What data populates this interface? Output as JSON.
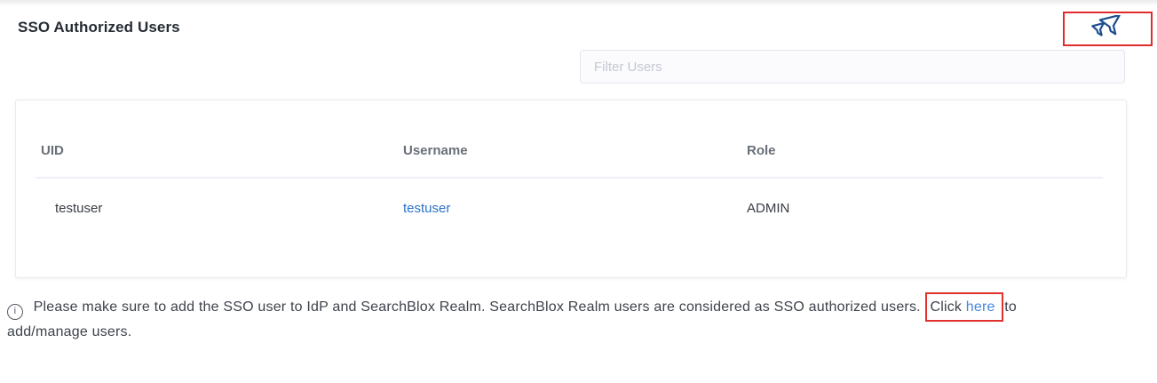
{
  "page": {
    "title": "SSO Authorized Users"
  },
  "filter": {
    "placeholder": "Filter Users",
    "icon": "double-funnel-filter"
  },
  "table": {
    "columns": [
      "UID",
      "Username",
      "Role"
    ],
    "rows": [
      {
        "uid": "testuser",
        "username": "testuser",
        "role": "ADMIN"
      }
    ]
  },
  "info": {
    "icon_glyph": "i",
    "text_before": "Please make sure to add the SSO user to IdP and SearchBlox Realm. SearchBlox Realm users are considered as SSO authorized users.",
    "click_text": "Click",
    "link_text": "here",
    "text_after": "to",
    "line2": "add/manage users."
  },
  "colors": {
    "annotation_red": "#e12b2b",
    "icon_blue": "#1c4e8d",
    "link_blue": "#2a72c8",
    "here_link_blue": "#4187e0",
    "header_gray": "#696f78",
    "text_dark": "#3d434b"
  }
}
